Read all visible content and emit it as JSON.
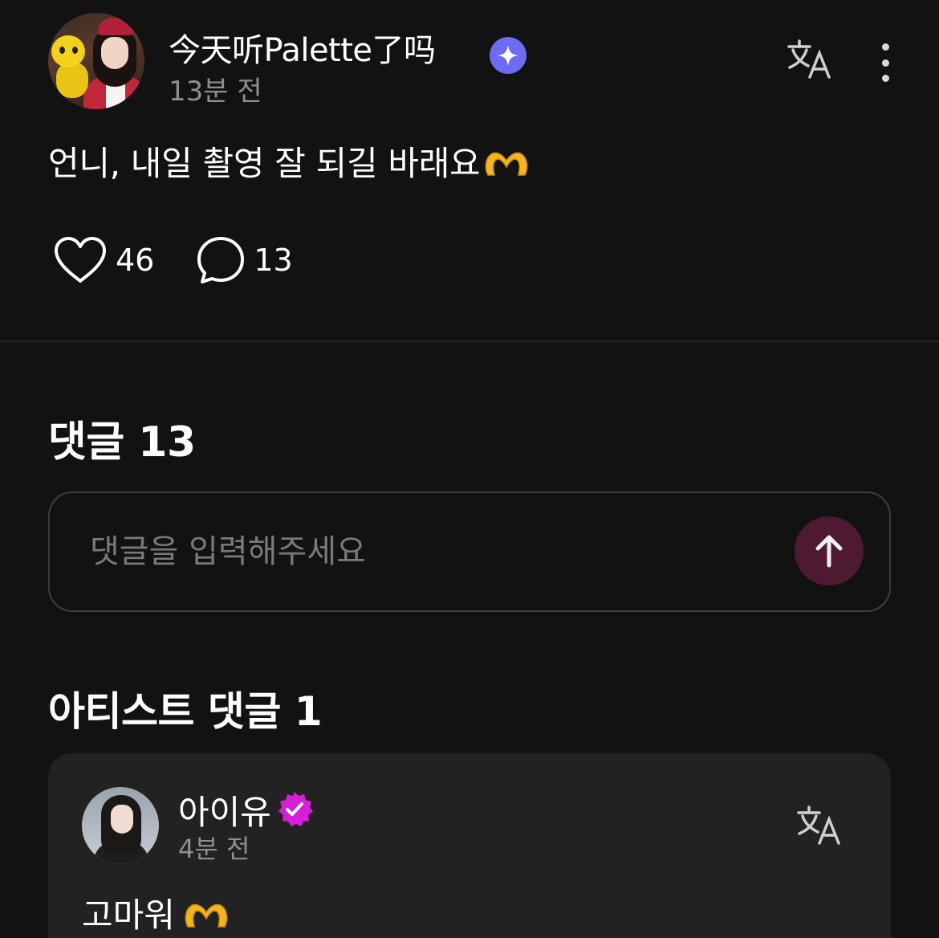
{
  "post": {
    "author": "今天听Palette了吗",
    "time": "13분 전",
    "text": "언니, 내일 촬영 잘 되길 바래요",
    "emoji": "heart-hands-emoji",
    "likes": "46",
    "comments": "13",
    "badge_color": "#6b6cf2"
  },
  "comments": {
    "title": "댓글 13",
    "placeholder": "댓글을 입력해주세요",
    "send_button_color": "#4e1a31"
  },
  "artist_comments": {
    "title": "아티스트 댓글 1",
    "items": [
      {
        "name": "아이유",
        "time": "4분 전",
        "text": "고마워",
        "emoji": "heart-hands-emoji",
        "badge_color": "#d61fd6"
      }
    ]
  },
  "icons": {
    "translate": "translate-icon",
    "more": "more-vertical-icon",
    "like": "heart-icon",
    "comment": "comment-bubble-icon",
    "send": "arrow-up-icon"
  }
}
